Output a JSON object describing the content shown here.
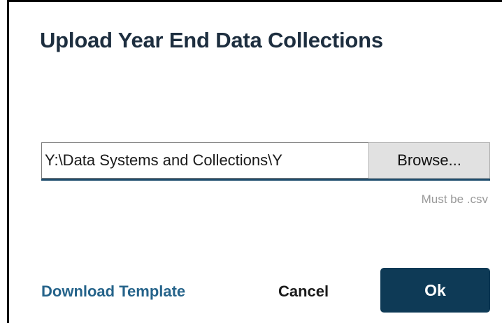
{
  "dialog": {
    "title": "Upload Year End Data Collections"
  },
  "file_picker": {
    "value": "Y:\\Data Systems and Collections\\Y",
    "browse_label": "Browse...",
    "hint": "Must be .csv"
  },
  "footer": {
    "download_label": "Download Template",
    "cancel_label": "Cancel",
    "ok_label": "Ok"
  },
  "colors": {
    "title": "#1d2e3f",
    "link": "#25638a",
    "primary_button": "#0e3a56",
    "input_underline": "#1f4e6e"
  }
}
